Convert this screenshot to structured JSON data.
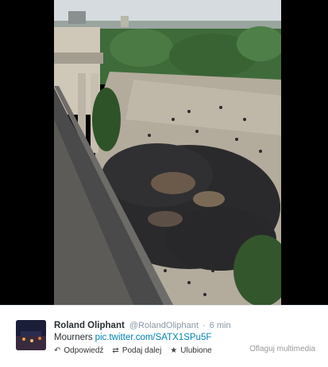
{
  "tweet": {
    "author_name": "Roland Oliphant",
    "author_handle": "@RolandOliphant",
    "separator": "·",
    "timestamp": "6 min",
    "text": "Mourners",
    "link": "pic.twitter.com/SATX1SPu5F"
  },
  "actions": {
    "reply_label": "Odpowiedź",
    "retweet_label": "Podaj dalej",
    "favorite_label": "Ulubione",
    "reply_icon": "reply-arrow-icon",
    "retweet_icon": "retweet-icon",
    "favorite_icon": "star-icon"
  },
  "media": {
    "flag_label": "Oflaguj multimedia"
  },
  "colors": {
    "link": "#0084b4",
    "muted": "#8899a6",
    "text": "#292f33"
  }
}
